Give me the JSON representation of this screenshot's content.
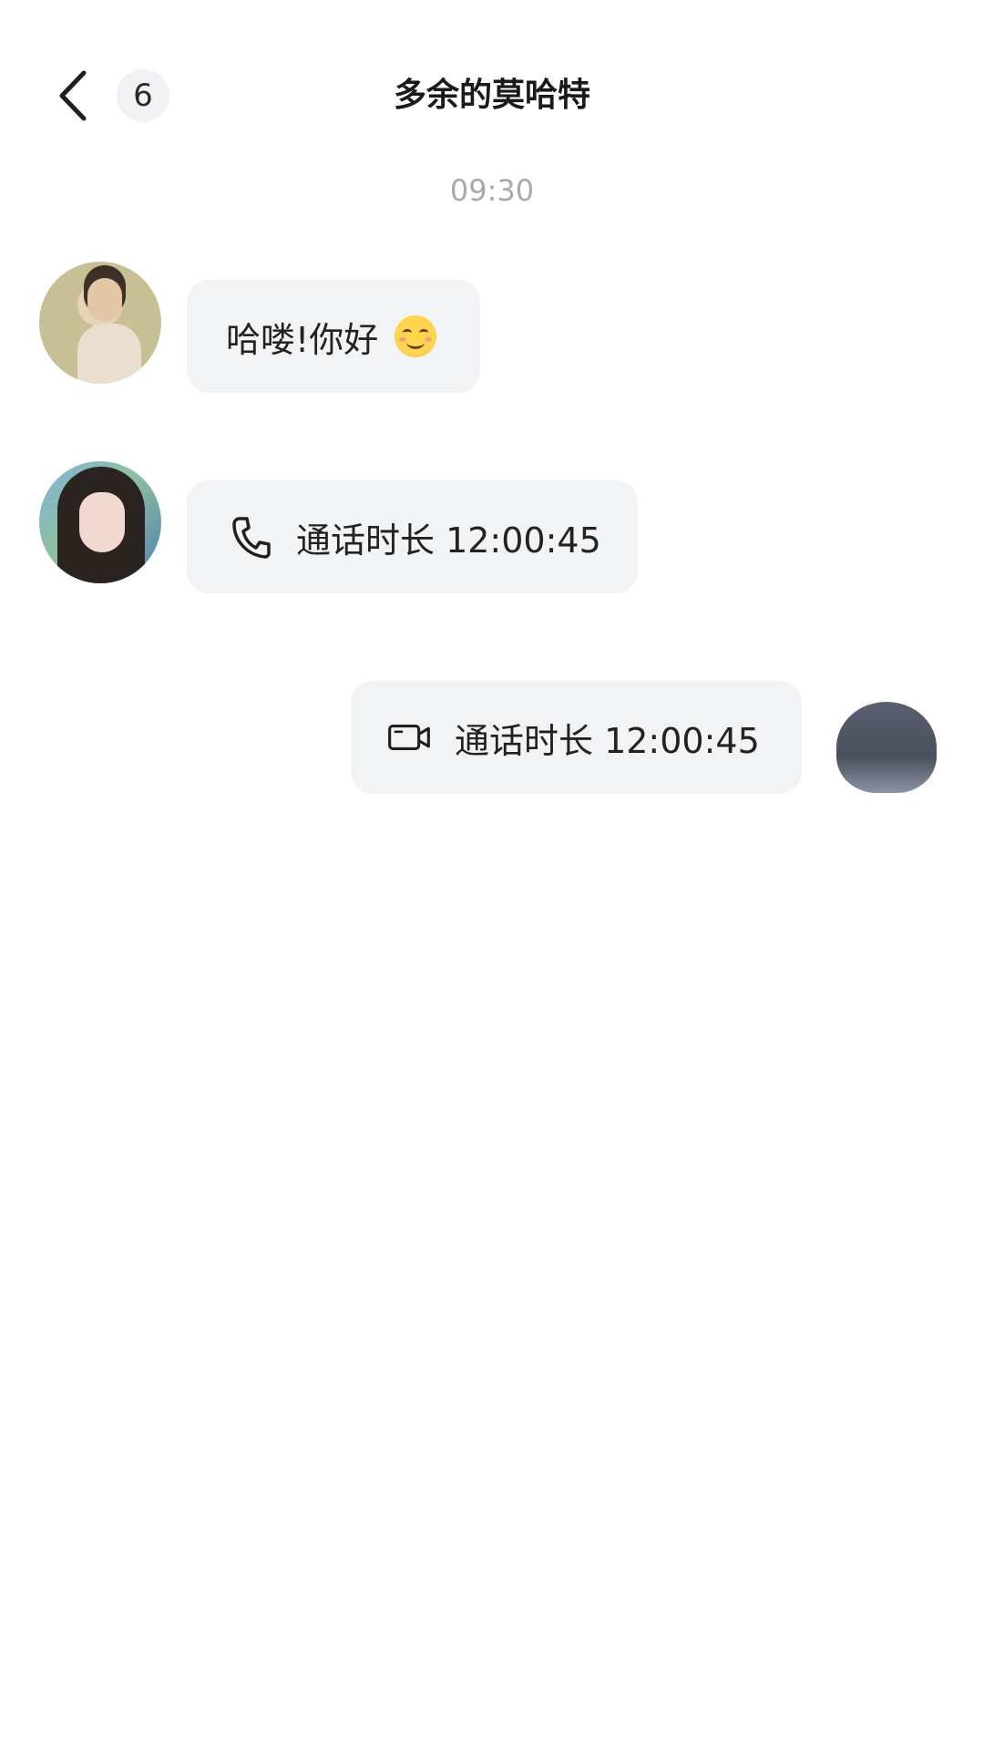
{
  "header": {
    "back_icon": "chevron-left-icon",
    "unread_count": "6",
    "title": "多余的莫哈特"
  },
  "timestamp": "09:30",
  "messages": [
    {
      "side": "left",
      "type": "text",
      "text": "哈喽!你好",
      "emoji": "smiling-face-icon"
    },
    {
      "side": "left",
      "type": "voice-call",
      "icon": "phone-icon",
      "text": "通话时长 12:00:45"
    },
    {
      "side": "right",
      "type": "video-call",
      "icon": "video-camera-icon",
      "text": "通话时长 12:00:45"
    }
  ],
  "colors": {
    "bubble_bg": "#f2f3f5",
    "timestamp": "#a8a8a8",
    "text": "#222222",
    "background": "#ffffff"
  }
}
